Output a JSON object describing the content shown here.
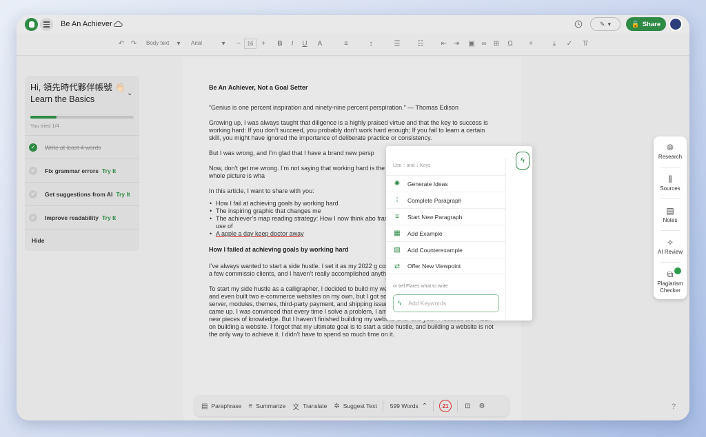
{
  "app": {
    "doc_title": "Be An Achiever",
    "share_label": "Share"
  },
  "toolbar": {
    "style_select": "Body text",
    "font_select": "Arial",
    "font_size": "16"
  },
  "learn": {
    "greeting": "Hi, 領先時代夥伴帳號 👋🏻",
    "subtitle": "Learn the Basics",
    "progress_fraction": 0.25,
    "tried_text": "You tried 1/4",
    "tasks": [
      {
        "label": "Write at least 4 words",
        "done": true,
        "cta": ""
      },
      {
        "label": "Fix grammar errors",
        "done": false,
        "cta": "Try It"
      },
      {
        "label": "Get suggestions from AI",
        "done": false,
        "cta": "Try It"
      },
      {
        "label": "Improve readability",
        "done": false,
        "cta": "Try It"
      }
    ],
    "hide_label": "Hide"
  },
  "doc": {
    "title": "Be An Achiever, Not a Goal Setter",
    "quote": "“Genius is one percent inspiration and ninety-nine percent perspiration.” — Thomas Edison",
    "p1": "Growing up, I was always taught that diligence is a highly praised virtue and that the key to success is working hard: If you don’t succeed, you probably don’t work hard enough; If you fail to learn a certain skill, you might have ignored the importance of deliberate practice or consistency.",
    "p2": "But I was wrong, and I’m glad that I have a brand new persp",
    "p3": "Now, don’t get me wrong. I’m not saying that working hard is the whole picture in achieving goals- the whole picture is wha",
    "p4": "In this article, I want to share with you:",
    "bullets": [
      "How I fail at achieving goals by working hard",
      "The inspiring graphic that changes me",
      "The achiever’s map reading strategy: How I now think abo framework for you to take away and make use of",
      "A apple a day keep doctor away"
    ],
    "h2": "How I failed at achieving goals by working hard",
    "p5": "I’ve always wanted to start a side hustle. I set it as my 2022 g confident about it. A year went by, I only got a few commissio clients, and I haven’t really accomplished anything about my",
    "p6": "To start my side hustle as a calligrapher, I decided to build my website. I tried several website platforms, and even built two e-commerce websites on my own, but I got so busy solving problems with my web server, modules, themes, third-party payment, and shipping issues. After solving one problem, another came up. I was convinced that every time I solve a problem, I am one step closer to my goal. I learned new pieces of knowledge. But I haven’t finished building my website after one year. I focused too much on building a website. I forgot that my ultimate goal is to start a side hustle, and building a website is not the only way to achieve it. I didn’t have to spend so much time on it."
  },
  "flares": {
    "hint": "Use ↑ and ↓ Keys",
    "items": [
      {
        "icon": "bulb-icon",
        "glyph": "💡",
        "label": "Generate Ideas"
      },
      {
        "icon": "complete-paragraph-icon",
        "glyph": "⋮",
        "label": "Complete Paragraph"
      },
      {
        "icon": "new-paragraph-icon",
        "glyph": "≡",
        "label": "Start New Paragraph"
      },
      {
        "icon": "example-icon",
        "glyph": "▦",
        "label": "Add Example"
      },
      {
        "icon": "counterexample-icon",
        "glyph": "▧",
        "label": "Add Counterexample"
      },
      {
        "icon": "viewpoint-icon",
        "glyph": "⇄",
        "label": "Offer New Viewpoint"
      }
    ],
    "or_text": "or tell Flares what to write",
    "keywords_placeholder": "Add Keywords"
  },
  "bottom_bar": {
    "paraphrase": "Paraphrase",
    "summarize": "Summarize",
    "translate": "Translate",
    "suggest": "Suggest Text",
    "word_count": "599 Words",
    "issues": "21"
  },
  "right_panel": {
    "research": "Research",
    "sources": "Sources",
    "notes": "Notes",
    "ai_review": "AI Review",
    "plagiarism": "Plagiarism Checker"
  },
  "help": "?",
  "colors": {
    "brand_green": "#2e8a44",
    "error_red": "#dd3333"
  }
}
